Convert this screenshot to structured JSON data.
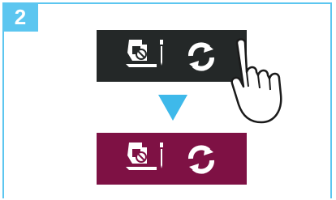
{
  "step": {
    "number": "2"
  },
  "colors": {
    "accent": "#5cc6f0",
    "arrow": "#3eb9ea",
    "panel_before": "#242828",
    "panel_after": "#7e1144"
  },
  "icons": {
    "presser_foot": "presser-foot-needle-icon",
    "rotate": "rotate-arrows-icon",
    "hand": "pointing-hand-icon",
    "arrow": "down-arrow-icon"
  }
}
